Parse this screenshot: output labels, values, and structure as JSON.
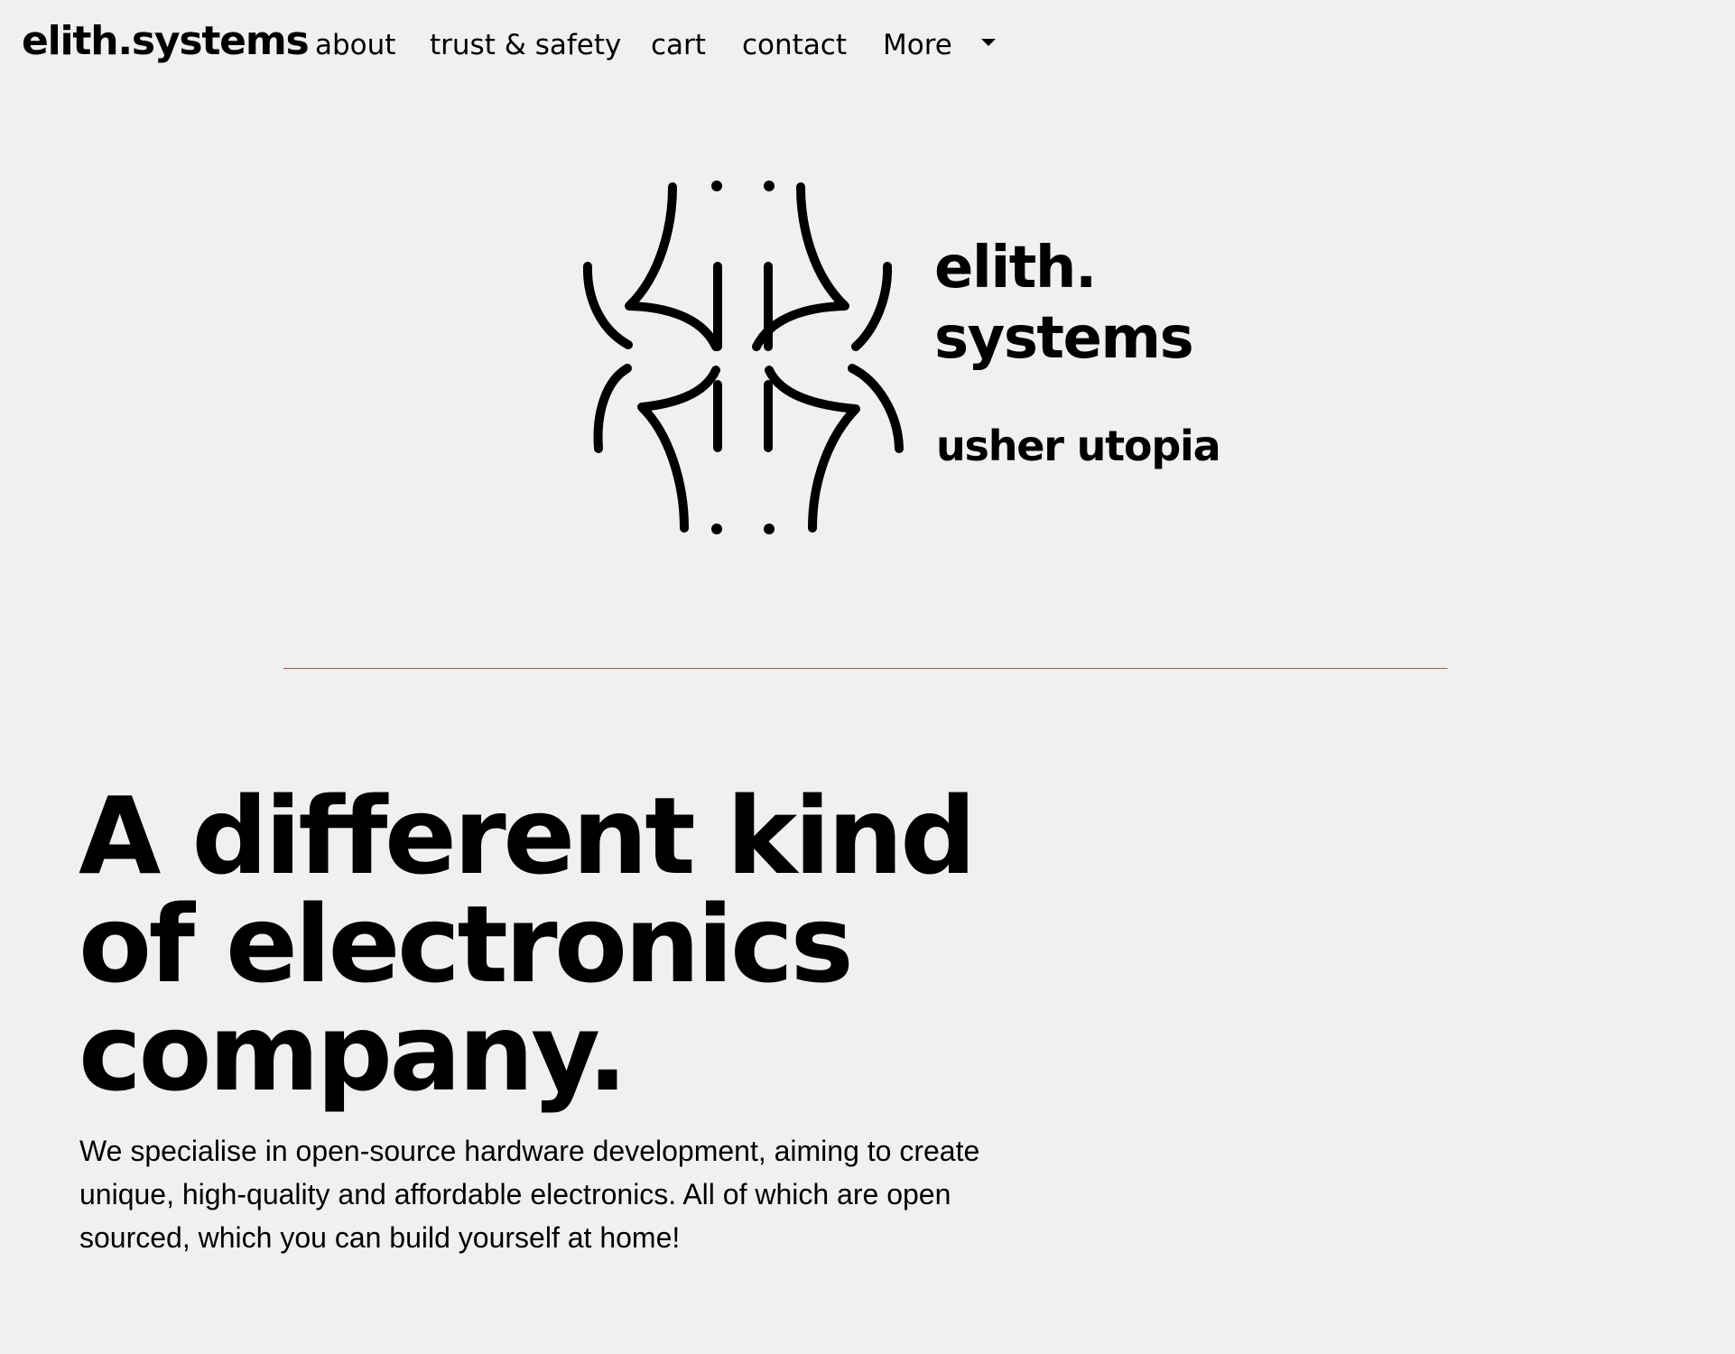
{
  "navbar": {
    "brand": "elith.systems",
    "links": [
      {
        "label": "about"
      },
      {
        "label": "trust & safety"
      },
      {
        "label": "cart"
      },
      {
        "label": "contact"
      },
      {
        "label": "More"
      }
    ],
    "more_icon": "caret-down-icon"
  },
  "hero": {
    "logo_icon": "elith-systems-logo-mark",
    "logo_title": "elith.\nsystems",
    "logo_subtitle": "usher utopia"
  },
  "main": {
    "headline": "A different kind of electronics company.",
    "intro": "We specialise in open-source hardware development, aiming to create unique, high-quality and affordable electronics. All of which are open sourced, which you can build yourself at home!"
  },
  "colors": {
    "background": "#f0f0f0",
    "text": "#000000",
    "divider": "#9a5a54"
  }
}
